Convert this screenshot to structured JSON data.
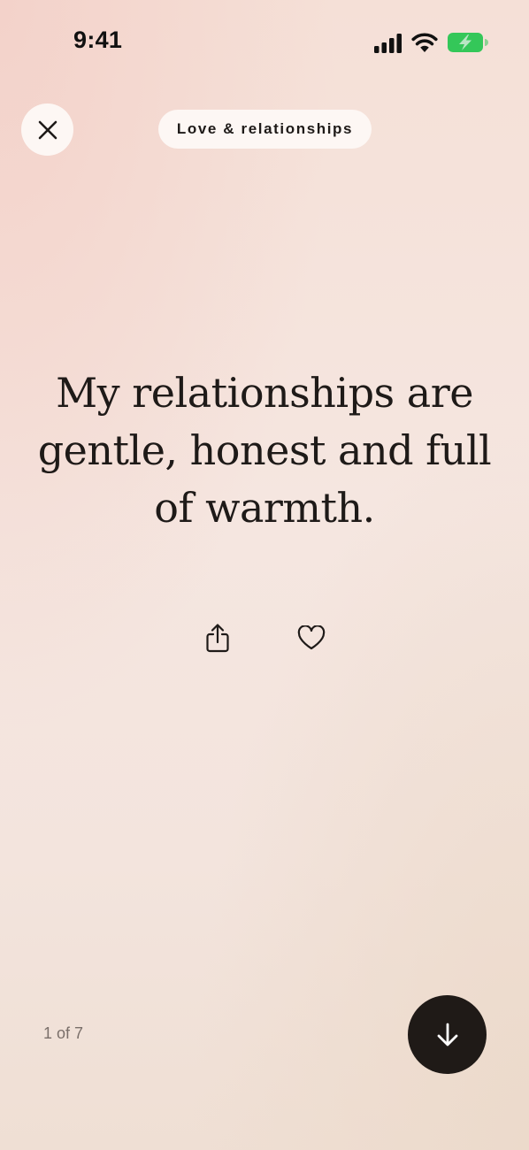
{
  "status_bar": {
    "time": "9:41",
    "icons": [
      "signal-icon",
      "wifi-icon",
      "battery-charging-icon"
    ],
    "battery_color": "#34c759"
  },
  "header": {
    "close_icon": "close-icon",
    "category_label": "Love & relationships"
  },
  "card": {
    "affirmation_lines": [
      "My relationships are",
      "gentle, honest and full",
      "of warmth."
    ],
    "actions": [
      "share-icon",
      "heart-icon"
    ]
  },
  "footer": {
    "page_counter": "1 of 7",
    "next_icon": "arrow-down-icon"
  },
  "colors": {
    "text": "#1e1a18",
    "pill_background": "#fdf7f4",
    "next_button_background": "#1f1a17"
  }
}
